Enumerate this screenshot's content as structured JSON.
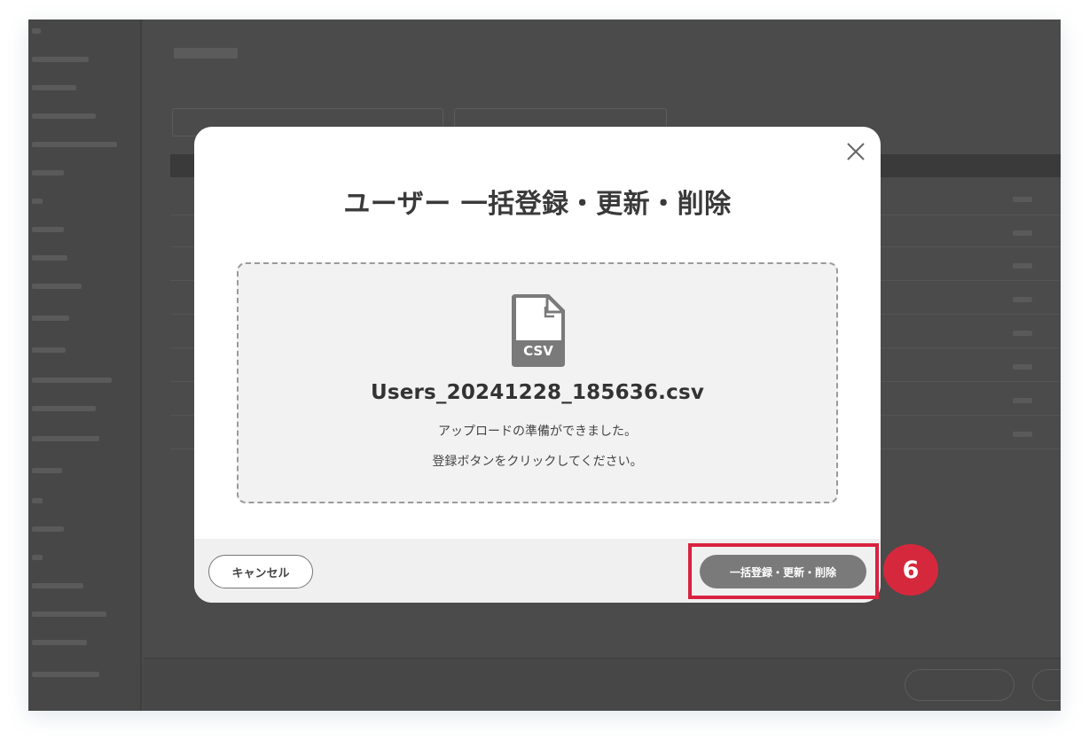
{
  "modal": {
    "title": "ユーザー 一括登録・更新・削除",
    "close_icon": "close-icon",
    "file_icon": "csv-file-icon",
    "file_type_label": "CSV",
    "file_name": "Users_20241228_185636.csv",
    "message_line1": "アップロードの準備ができました。",
    "message_line2": "登録ボタンをクリックしてください。",
    "cancel_label": "キャンセル",
    "submit_label": "一括登録・更新・削除"
  },
  "annotation": {
    "step_number": "6",
    "color": "#d8223f"
  },
  "colors": {
    "overlay": "#4a4a4a",
    "submit_button": "#7a7a7a",
    "dropzone_bg": "#f2f2f2"
  }
}
